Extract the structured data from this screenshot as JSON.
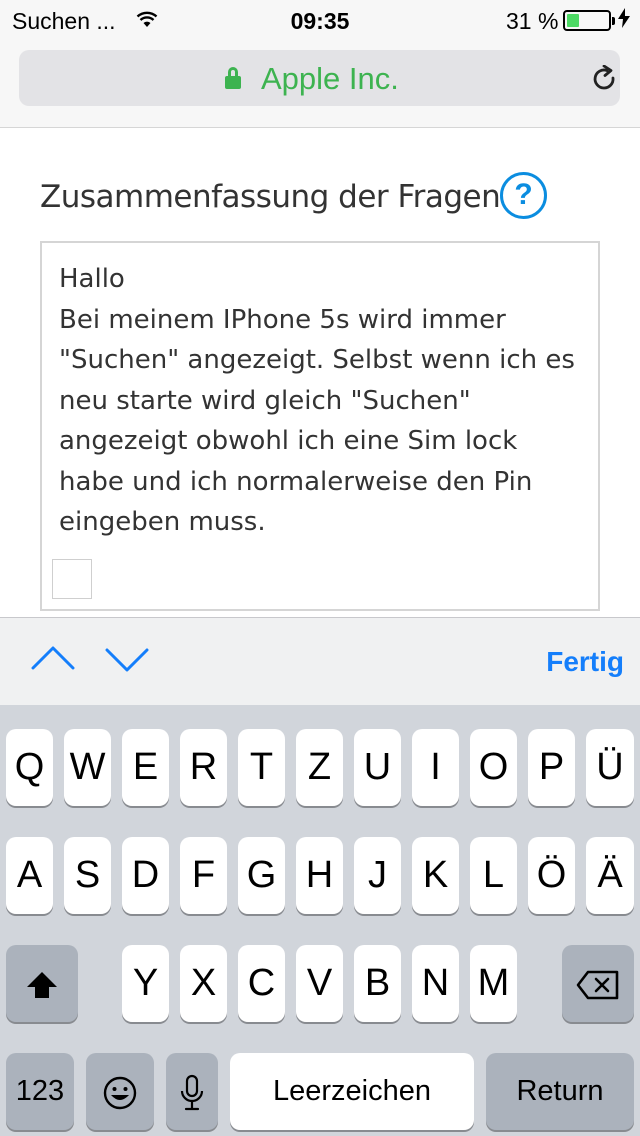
{
  "status_bar": {
    "carrier": "Suchen ...",
    "time": "09:35",
    "battery_percent": "31 %",
    "battery_level": 0.31,
    "battery_color": "#4cd964",
    "icons": [
      "wifi-icon",
      "battery-icon",
      "charging-bolt-icon"
    ]
  },
  "browser": {
    "site_label": "Apple Inc.",
    "secure": true,
    "accent_color": "#3db350",
    "icons": [
      "lock-icon",
      "reload-icon"
    ]
  },
  "page": {
    "question_title": "Zusammenfassung der Fragen",
    "help_label": "?",
    "textarea_value": "Hallo\nBei meinem IPhone 5s wird immer\n\"Suchen\" angezeigt. Selbst wenn ich es\nneu starte wird gleich \"Suchen\"\nangezeigt obwohl ich eine Sim lock\nhabe und ich normalerweise den Pin\neingeben muss."
  },
  "accessory_bar": {
    "done_label": "Fertig",
    "icons": [
      "chevron-up-icon",
      "chevron-down-icon"
    ],
    "accent_color": "#147efb"
  },
  "keyboard": {
    "row1": [
      "Q",
      "W",
      "E",
      "R",
      "T",
      "Z",
      "U",
      "I",
      "O",
      "P",
      "Ü"
    ],
    "row2": [
      "A",
      "S",
      "D",
      "F",
      "G",
      "H",
      "J",
      "K",
      "L",
      "Ö",
      "Ä"
    ],
    "row3": [
      "Y",
      "X",
      "C",
      "V",
      "B",
      "N",
      "M"
    ],
    "numbers_label": "123",
    "space_label": "Leerzeichen",
    "return_label": "Return",
    "icons": [
      "shift-icon",
      "delete-icon",
      "emoji-icon",
      "microphone-icon"
    ]
  }
}
